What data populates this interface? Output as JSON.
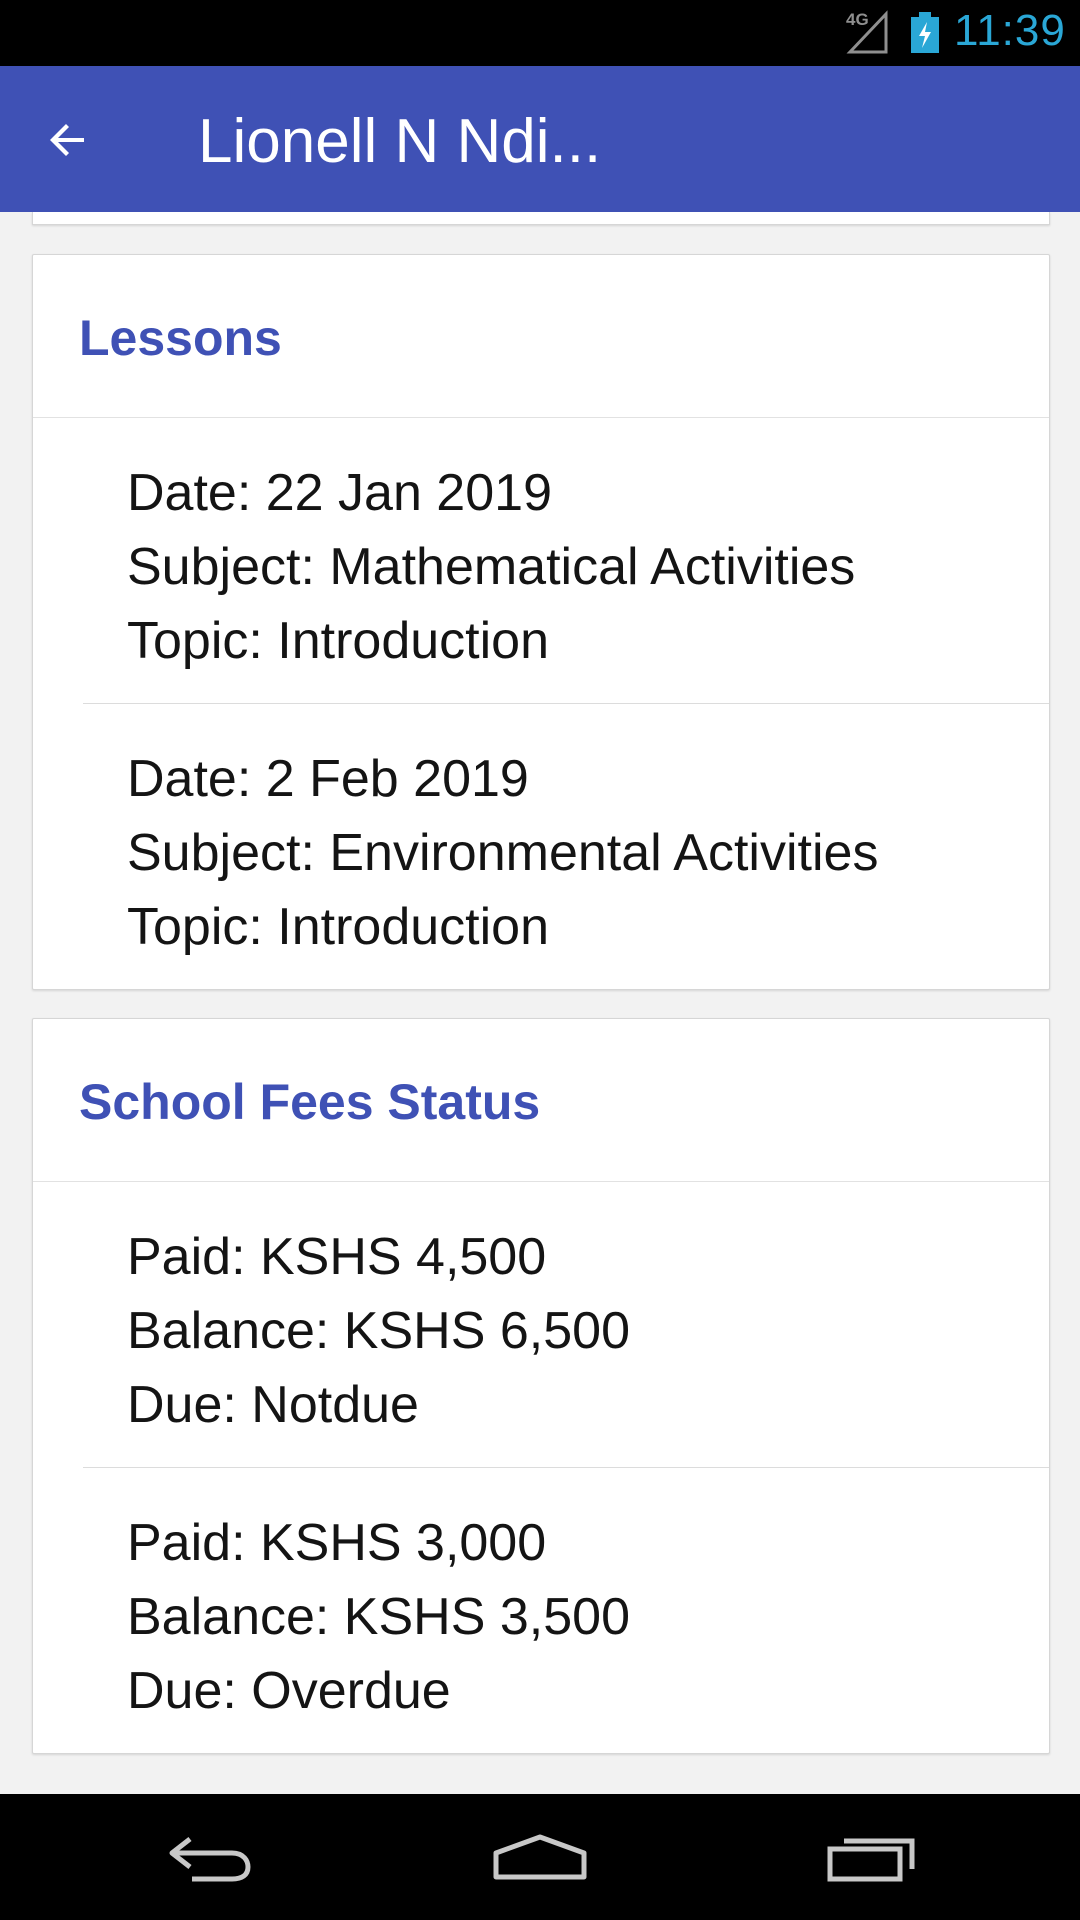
{
  "status_bar": {
    "network_label": "4G",
    "time": "11:39",
    "clock_color": "#2aa7d6"
  },
  "app_bar": {
    "title": "Lionell N Ndi...",
    "background_color": "#3f51b5",
    "back_icon": "arrow-back-icon"
  },
  "lessons": {
    "title": "Lessons",
    "items": [
      {
        "date": "Date: 22 Jan 2019",
        "subject": "Subject: Mathematical Activities",
        "topic": "Topic: Introduction"
      },
      {
        "date": "Date: 2 Feb 2019",
        "subject": "Subject: Environmental Activities",
        "topic": "Topic: Introduction"
      }
    ]
  },
  "school_fees": {
    "title": "School Fees Status",
    "items": [
      {
        "paid": "Paid: KSHS 4,500",
        "balance": "Balance: KSHS 6,500",
        "due": "Due: Notdue"
      },
      {
        "paid": "Paid: KSHS 3,000",
        "balance": "Balance: KSHS 3,500",
        "due": "Due: Overdue"
      }
    ]
  },
  "nav_bar": {
    "icons": [
      "back-nav-icon",
      "home-nav-icon",
      "recent-apps-icon"
    ]
  },
  "colors": {
    "accent": "#3f51b5",
    "text": "#141414",
    "background": "#f2f2f2"
  }
}
